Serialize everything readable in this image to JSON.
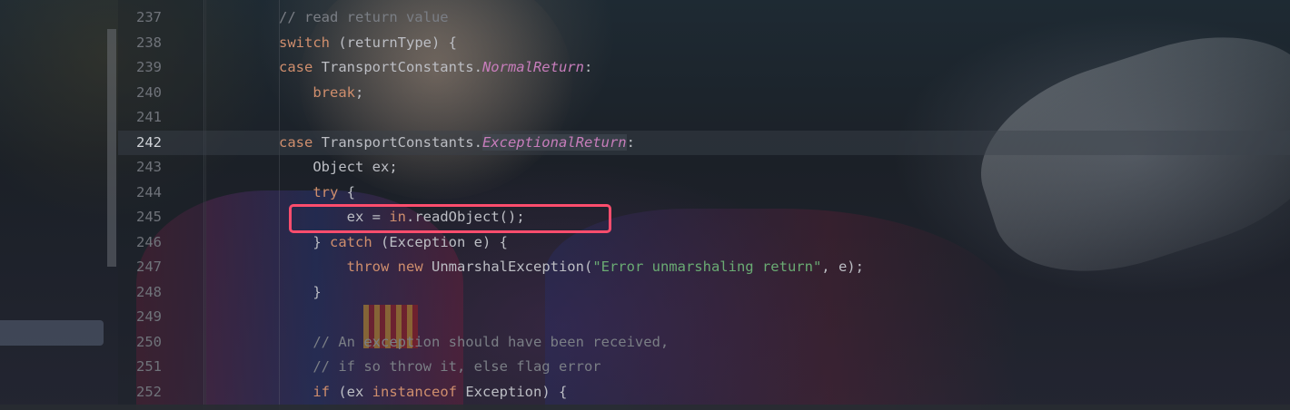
{
  "editor": {
    "current_line": "242",
    "lines": [
      {
        "number": "237",
        "tokens": [
          {
            "t": "// read return value",
            "c": "cmt"
          }
        ]
      },
      {
        "number": "238",
        "tokens": [
          {
            "t": "switch",
            "c": "kw"
          },
          {
            "t": " (returnType) {",
            "c": "id"
          }
        ]
      },
      {
        "number": "239",
        "tokens": [
          {
            "t": "case",
            "c": "kw"
          },
          {
            "t": " TransportConstants.",
            "c": "id"
          },
          {
            "t": "NormalReturn",
            "c": "fld"
          },
          {
            "t": ":",
            "c": "id"
          }
        ]
      },
      {
        "number": "240",
        "tokens": [
          {
            "t": "    ",
            "c": "id"
          },
          {
            "t": "break",
            "c": "kw"
          },
          {
            "t": ";",
            "c": "id"
          }
        ]
      },
      {
        "number": "241",
        "tokens": []
      },
      {
        "number": "242",
        "tokens": [
          {
            "t": "case",
            "c": "kw"
          },
          {
            "t": " TransportConstants.",
            "c": "id"
          },
          {
            "t": "ExceptionalReturn",
            "c": "fld fld-hl"
          },
          {
            "t": ":",
            "c": "id"
          }
        ]
      },
      {
        "number": "243",
        "tokens": [
          {
            "t": "    Object ex;",
            "c": "id"
          }
        ]
      },
      {
        "number": "244",
        "tokens": [
          {
            "t": "    ",
            "c": "id"
          },
          {
            "t": "try",
            "c": "kw"
          },
          {
            "t": " {",
            "c": "id"
          }
        ]
      },
      {
        "number": "245",
        "tokens": [
          {
            "t": "        ex = ",
            "c": "id"
          },
          {
            "t": "in",
            "c": "kw"
          },
          {
            "t": ".readObject();",
            "c": "id"
          }
        ]
      },
      {
        "number": "246",
        "tokens": [
          {
            "t": "    } ",
            "c": "id"
          },
          {
            "t": "catch",
            "c": "kw"
          },
          {
            "t": " (Exception e) {",
            "c": "id"
          }
        ]
      },
      {
        "number": "247",
        "tokens": [
          {
            "t": "        ",
            "c": "id"
          },
          {
            "t": "throw",
            "c": "kw"
          },
          {
            "t": " ",
            "c": "id"
          },
          {
            "t": "new",
            "c": "kw"
          },
          {
            "t": " UnmarshalException(",
            "c": "id"
          },
          {
            "t": "\"Error unmarshaling return\"",
            "c": "str"
          },
          {
            "t": ", e);",
            "c": "id"
          }
        ]
      },
      {
        "number": "248",
        "tokens": [
          {
            "t": "    }",
            "c": "id"
          }
        ]
      },
      {
        "number": "249",
        "tokens": []
      },
      {
        "number": "250",
        "tokens": [
          {
            "t": "    // An exception should have been received,",
            "c": "cmt"
          }
        ]
      },
      {
        "number": "251",
        "tokens": [
          {
            "t": "    // if so throw it, else flag error",
            "c": "cmt"
          }
        ]
      },
      {
        "number": "252",
        "tokens": [
          {
            "t": "    ",
            "c": "id"
          },
          {
            "t": "if",
            "c": "kw"
          },
          {
            "t": " (ex ",
            "c": "id"
          },
          {
            "t": "instanceof",
            "c": "kw"
          },
          {
            "t": " Exception) {",
            "c": "id"
          }
        ]
      }
    ]
  },
  "colors": {
    "keyword": "#cf8e6d",
    "field": "#c77dbb",
    "string": "#6aab73",
    "comment": "#7a7e85",
    "highlight_box": "#ff4d6d"
  }
}
